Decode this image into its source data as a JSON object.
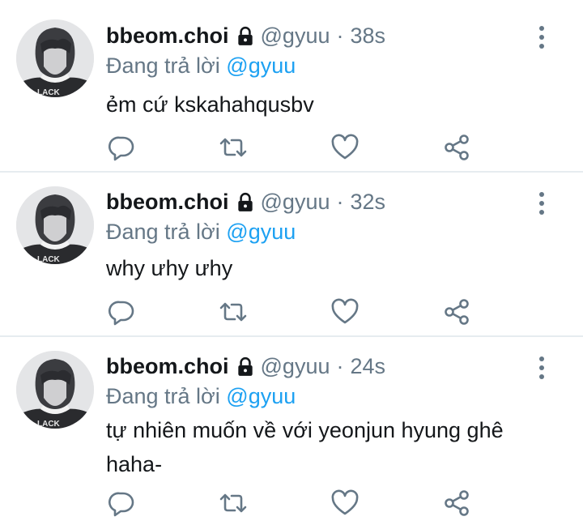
{
  "tweets": [
    {
      "name": "bbeom.choi",
      "handle": "@gyuu",
      "dot": "·",
      "time": "38s",
      "replying_prefix": "Đang trả lời",
      "replying_to": "@gyuu",
      "text": "ẻm cứ kskahahqusbv"
    },
    {
      "name": "bbeom.choi",
      "handle": "@gyuu",
      "dot": "·",
      "time": "32s",
      "replying_prefix": "Đang trả lời",
      "replying_to": "@gyuu",
      "text": "why ưhy ưhy"
    },
    {
      "name": "bbeom.choi",
      "handle": "@gyuu",
      "dot": "·",
      "time": "24s",
      "replying_prefix": "Đang trả lời",
      "replying_to": "@gyuu",
      "text": "tự nhiên muốn về với yeonjun hyung ghê haha-"
    }
  ],
  "avatar_shirt_text": "LACK",
  "icons": {
    "lock": "lock-icon",
    "more": "more-vertical-icon",
    "reply": "reply-icon",
    "retweet": "retweet-icon",
    "like": "heart-icon",
    "share": "share-icon"
  },
  "colors": {
    "text": "#14171a",
    "secondary": "#657786",
    "link": "#1da1f2",
    "divider": "#e6ecf0"
  }
}
